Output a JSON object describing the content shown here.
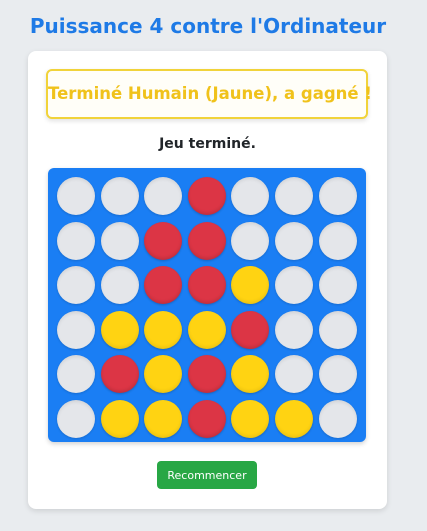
{
  "header": {
    "title": "Puissance 4 contre l'Ordinateur"
  },
  "game": {
    "result_message": "Terminé Humain (Jaune), a gagné !",
    "status": "Jeu terminé.",
    "restart_label": "Recommencer",
    "colors": {
      "board": "#1a7ef4",
      "red": "#dc3545",
      "yellow": "#ffd312",
      "empty": "#e4e6ea",
      "title": "#1e7ae6",
      "button": "#28a745"
    },
    "board": [
      [
        "empty",
        "empty",
        "empty",
        "red",
        "empty",
        "empty",
        "empty"
      ],
      [
        "empty",
        "empty",
        "red",
        "red",
        "empty",
        "empty",
        "empty"
      ],
      [
        "empty",
        "empty",
        "red",
        "red",
        "yellow",
        "empty",
        "empty"
      ],
      [
        "empty",
        "yellow",
        "yellow",
        "yellow",
        "red",
        "empty",
        "empty"
      ],
      [
        "empty",
        "red",
        "yellow",
        "red",
        "yellow",
        "empty",
        "empty"
      ],
      [
        "empty",
        "yellow",
        "yellow",
        "red",
        "yellow",
        "yellow",
        "empty"
      ]
    ]
  }
}
